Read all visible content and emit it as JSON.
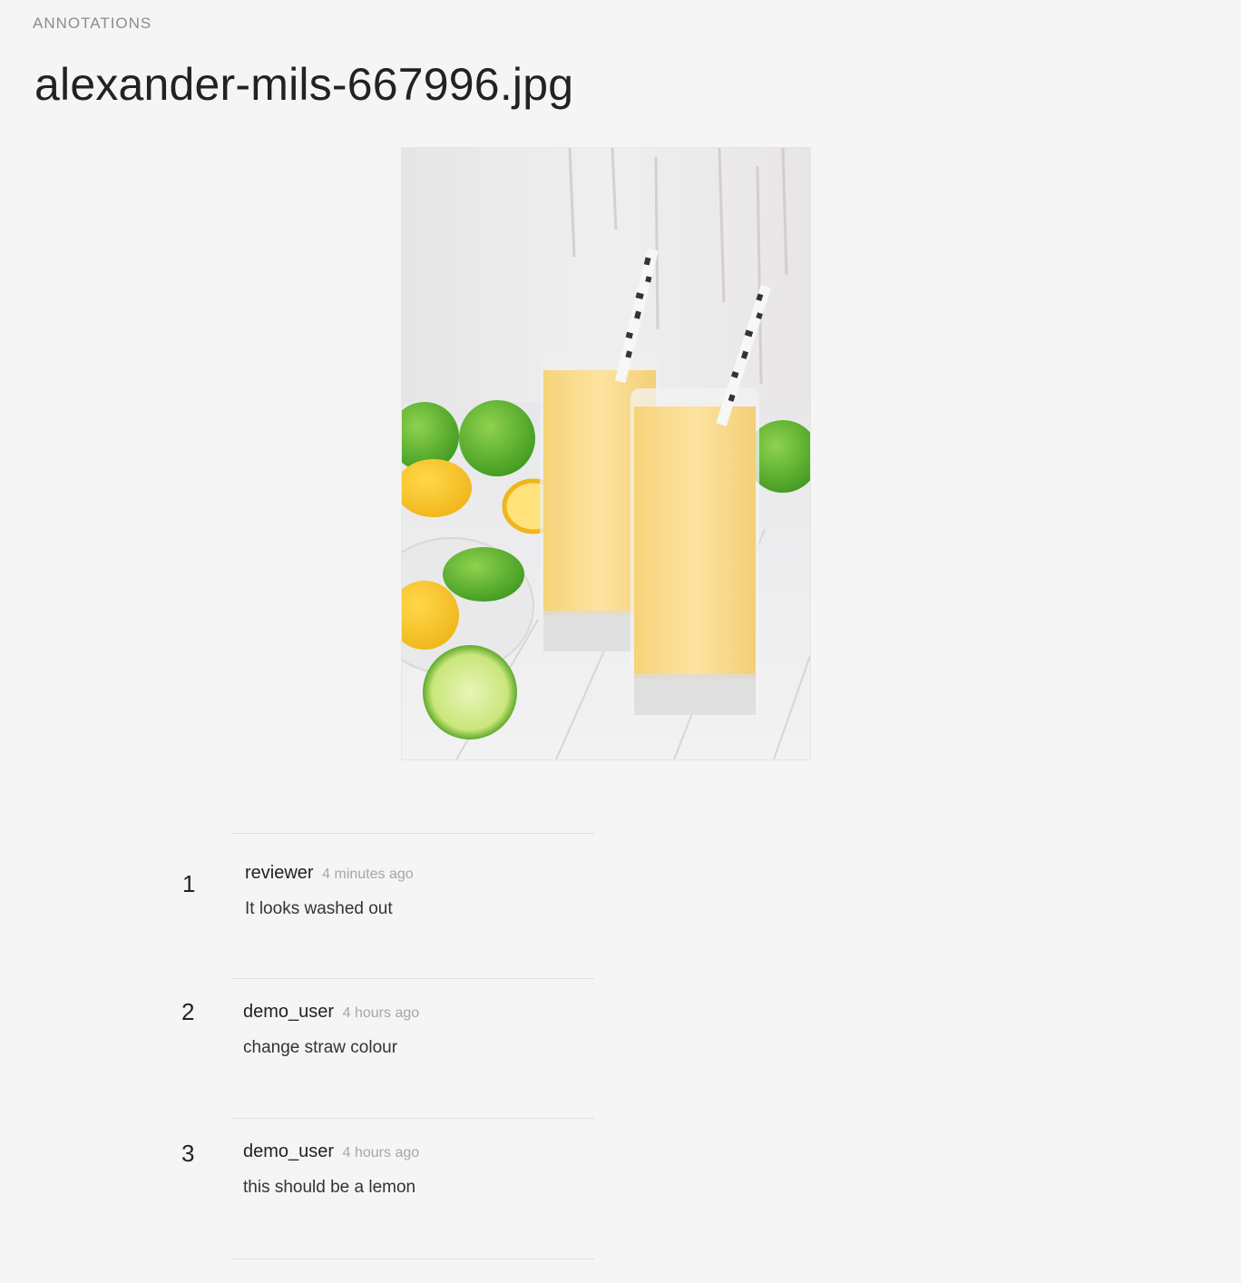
{
  "header": {
    "section_label": "ANNOTATIONS",
    "file_title": "alexander-mils-667996.jpg"
  },
  "image": {
    "alt": "Two glasses of orange smoothie with striped straws, limes and lemons"
  },
  "annotations": [
    {
      "number": "1",
      "user": "reviewer",
      "time": "4 minutes ago",
      "text": "It looks washed out"
    },
    {
      "number": "2",
      "user": "demo_user",
      "time": "4 hours ago",
      "text": "change straw colour"
    },
    {
      "number": "3",
      "user": "demo_user",
      "time": "4 hours ago",
      "text": "this should be a lemon"
    }
  ]
}
